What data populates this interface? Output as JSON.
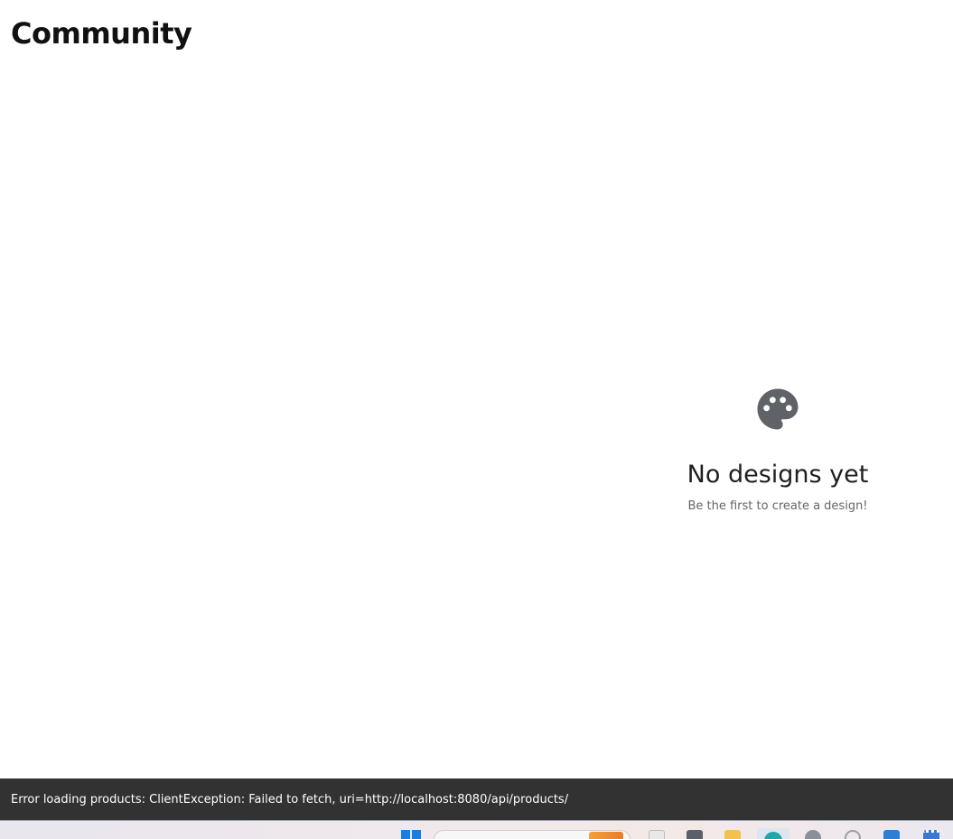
{
  "page": {
    "title": "Community"
  },
  "empty_state": {
    "icon": "palette-icon",
    "title": "No designs yet",
    "subtitle": "Be the first to create a design!"
  },
  "snackbar": {
    "message": "Error loading products: ClientException: Failed to fetch, uri=http://localhost:8080/api/products/"
  },
  "taskbar": {
    "icons": [
      "windows-start-icon",
      "search-box",
      "notepad-icon",
      "terminal-icon",
      "file-explorer-icon",
      "browser-icon",
      "settings-icon",
      "clock-icon",
      "mail-icon",
      "calendar-icon"
    ]
  },
  "colors": {
    "snackbar_bg": "#323232",
    "icon": "#5f6368",
    "title": "#111111"
  }
}
